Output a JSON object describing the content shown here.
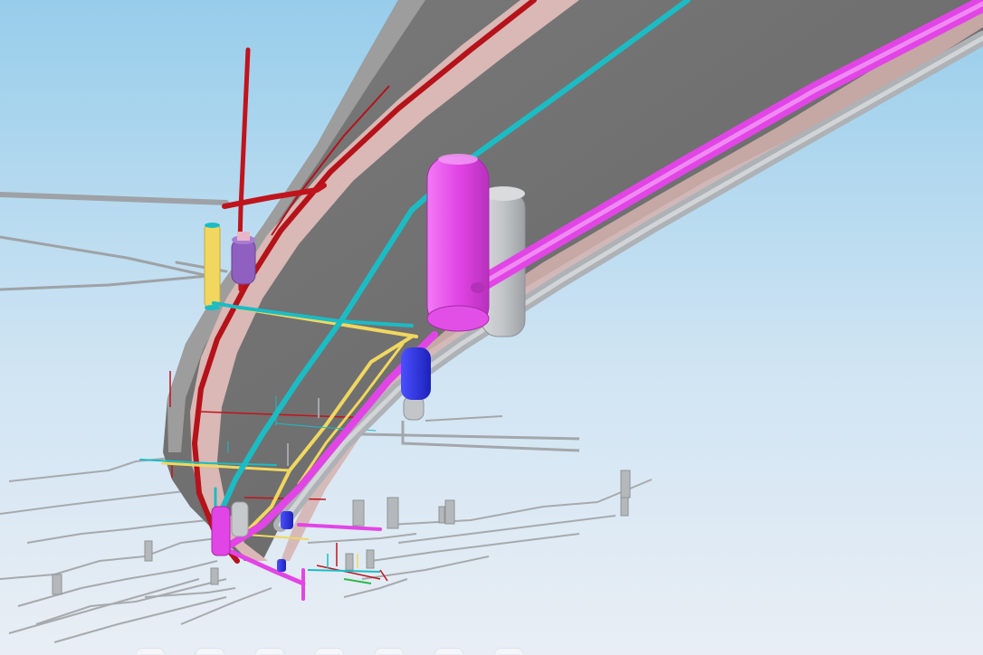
{
  "viewer": {
    "mode": "3d-model-view",
    "background_top": "#97cdeb",
    "background_bottom": "#e9eef5"
  },
  "colors": {
    "tunnel_shell": "#6c6c6c",
    "tunnel_shell_top": "#9a9a9a",
    "tunnel_lining": "#d7b4b2",
    "fire_main_red": "#c0141c",
    "ventilation_magenta": "#e245e6",
    "drainage_cyan": "#1bbcc4",
    "compressed_air_grey": "#b8bcc0",
    "power_yellow": "#f1d760",
    "pump_blue": "#2a2fe0",
    "tank_purple": "#8f60c0"
  },
  "layers": [
    {
      "name": "tunnel-shell"
    },
    {
      "name": "tunnel-lining"
    },
    {
      "name": "fire-main-pipe"
    },
    {
      "name": "ventilation-duct"
    },
    {
      "name": "drainage-pipe"
    },
    {
      "name": "compressed-air-pipe"
    },
    {
      "name": "power-cable-tray"
    },
    {
      "name": "lower-level-pipework"
    }
  ]
}
